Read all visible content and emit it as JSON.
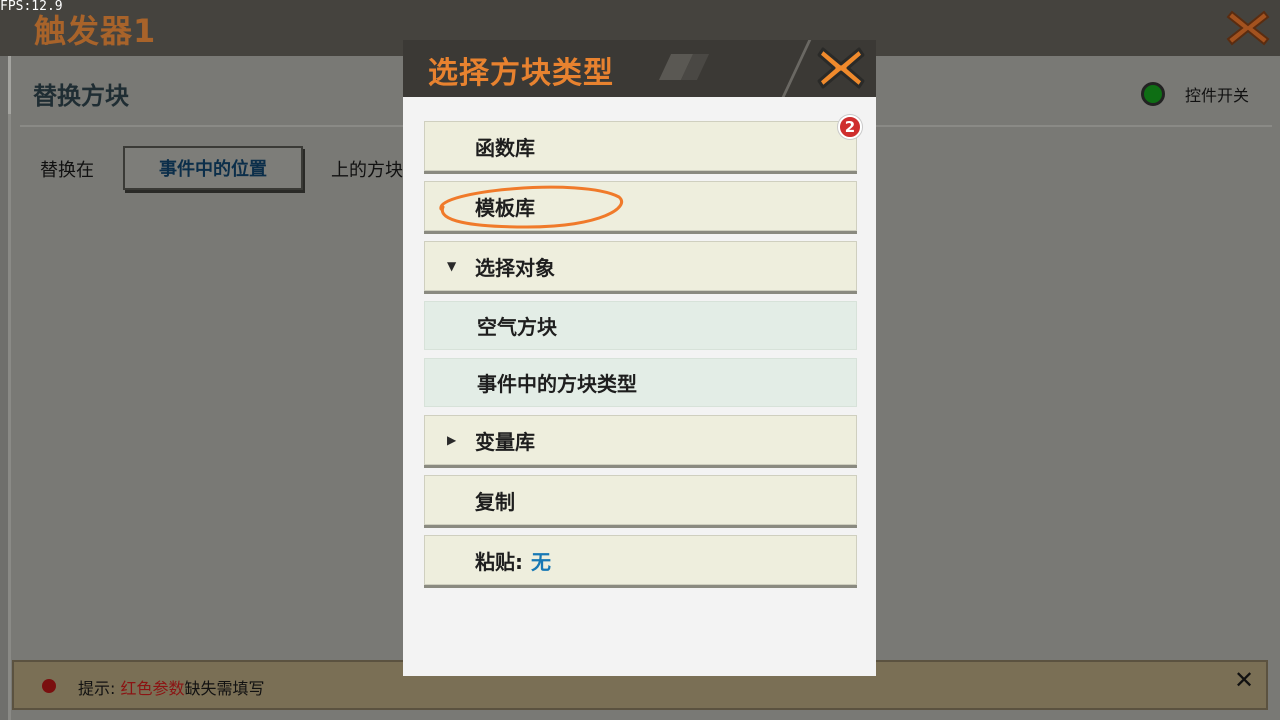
{
  "fps": "FPS:12.9",
  "window": {
    "title": "触发器1"
  },
  "panel": {
    "title": "替换方块",
    "replace_label": "替换在",
    "position_button": "事件中的位置",
    "on_label": "上的方块",
    "toggle_label": "控件开关",
    "toggle_color": "#0e6e14"
  },
  "hint": {
    "prefix": "提示:",
    "red_part": "红色参数",
    "suffix": "缺失需填写",
    "close": "✕"
  },
  "dialog": {
    "title": "选择方块类型",
    "badge_count": "2",
    "items": [
      {
        "label": "函数库"
      },
      {
        "label": "模板库"
      },
      {
        "label": "选择对象",
        "arrow": "▼"
      },
      {
        "label": "空气方块"
      },
      {
        "label": "事件中的方块类型"
      },
      {
        "label": "变量库",
        "arrow": "▶"
      },
      {
        "label": "复制"
      },
      {
        "label": "粘贴:",
        "value": "无"
      }
    ]
  },
  "colors": {
    "accent_orange": "#e8822f",
    "badge_red": "#cf2e2e",
    "link_blue": "#1778b5",
    "annotation_orange": "#f07a2a"
  }
}
